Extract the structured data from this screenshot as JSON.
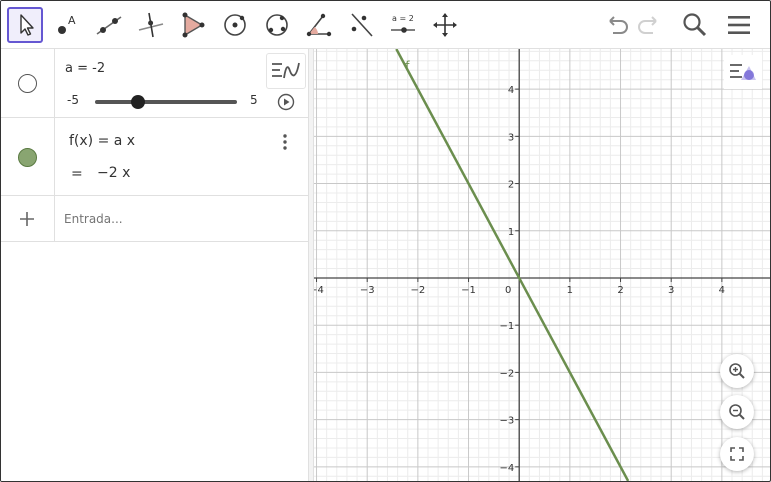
{
  "toolbar": {
    "tools": [
      {
        "name": "move-tool",
        "icon": "cursor-arrow-icon",
        "active": true
      },
      {
        "name": "point-tool",
        "icon": "point-a-icon",
        "label": "A"
      },
      {
        "name": "line-tool",
        "icon": "line-through-points-icon"
      },
      {
        "name": "perpendicular-tool",
        "icon": "perpendicular-line-icon"
      },
      {
        "name": "polygon-tool",
        "icon": "polygon-icon"
      },
      {
        "name": "circle-tool",
        "icon": "circle-center-point-icon"
      },
      {
        "name": "circle-three-points-tool",
        "icon": "circle-three-points-icon"
      },
      {
        "name": "angle-tool",
        "icon": "angle-icon"
      },
      {
        "name": "reflect-tool",
        "icon": "reflect-line-icon"
      },
      {
        "name": "slider-tool",
        "icon": "slider-icon",
        "label": "a = 2"
      },
      {
        "name": "move-view-tool",
        "icon": "move-graphics-view-icon"
      }
    ],
    "right_buttons": [
      "undo-icon",
      "redo-icon",
      "search-icon",
      "menu-icon"
    ]
  },
  "algebra": {
    "slider": {
      "definition": "a = -2",
      "min_label": "-5",
      "max_label": "5",
      "min": -5,
      "max": 5,
      "value": -2
    },
    "function": {
      "definition": "f(x) = a x",
      "prefix": "=",
      "value": "−2 x",
      "color": "#6b8e4e"
    },
    "input": {
      "placeholder": "Entrada..."
    }
  },
  "graphics": {
    "curve_label": "f",
    "x_ticks": [
      "−4",
      "−3",
      "−2",
      "−1",
      "0",
      "1",
      "2",
      "3",
      "4"
    ],
    "y_ticks": [
      "4",
      "3",
      "2",
      "1",
      "−1",
      "−2",
      "−3",
      "−4"
    ],
    "x_range": [
      -4.05,
      4.95
    ],
    "y_range": [
      -4.3,
      4.85
    ],
    "function_slope": -2,
    "curve_color": "#6b8e4e",
    "buttons": [
      "zoom-in-icon",
      "zoom-out-icon",
      "fullscreen-icon"
    ]
  },
  "colors": {
    "accent": "#6557d2",
    "grid_minor": "#ececec",
    "grid_major": "#c8c8c8",
    "axis": "#444444"
  }
}
